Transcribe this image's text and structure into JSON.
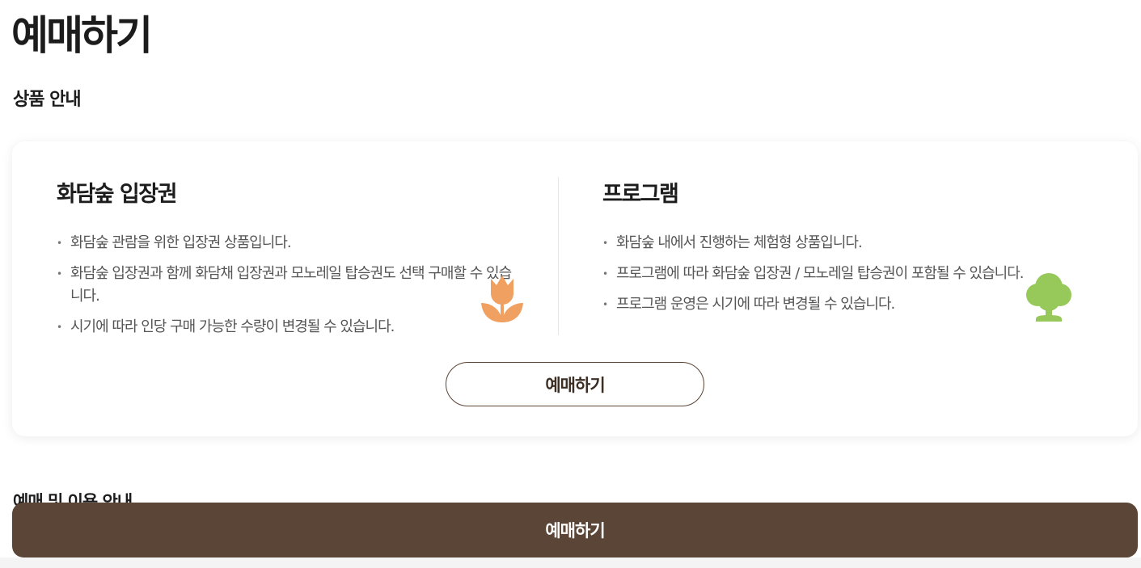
{
  "page": {
    "title": "예매하기"
  },
  "product_info": {
    "heading": "상품 안내",
    "products": [
      {
        "title": "화담숲 입장권",
        "icon": "tulip-icon",
        "icon_color": "#F0A060",
        "features": [
          "화담숲 관람을 위한 입장권 상품입니다.",
          "화담숲 입장권과 함께 화담채 입장권과 모노레일 탑승권도 선택 구매할 수 있습니다.",
          "시기에 따라 인당 구매 가능한 수량이 변경될 수 있습니다."
        ]
      },
      {
        "title": "프로그램",
        "icon": "tree-icon",
        "icon_color": "#96C85A",
        "features": [
          "화담숲 내에서 진행하는 체험형 상품입니다.",
          "프로그램에 따라 화담숲 입장권 / 모노레일 탑승권이 포함될 수 있습니다.",
          "프로그램 운영은 시기에 따라 변경될 수 있습니다."
        ]
      }
    ],
    "button_label": "예매하기"
  },
  "usage_info": {
    "heading": "예매 및 이용 안내"
  },
  "sticky_cta": {
    "label": "예매하기"
  },
  "colors": {
    "brand_brown": "#5A4536",
    "card_shadow": "rgba(0,0,0,0.08)"
  }
}
